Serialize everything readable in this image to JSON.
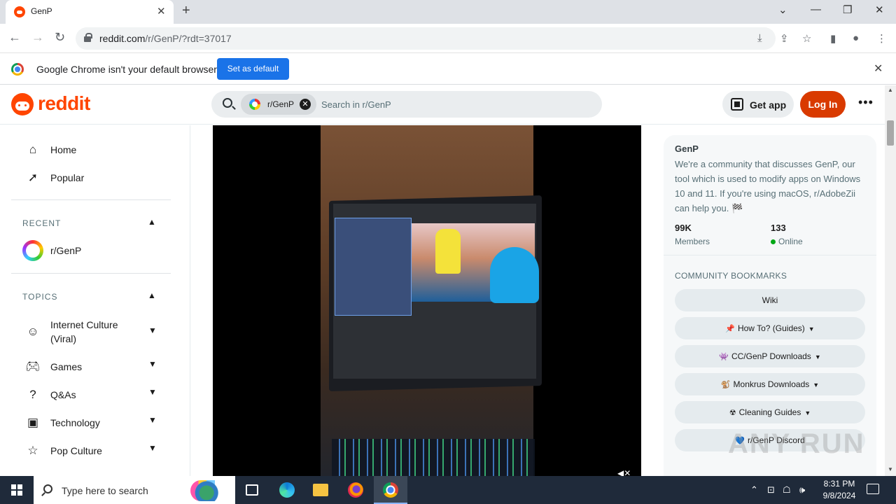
{
  "browser": {
    "tab_title": "GenP",
    "url_host": "reddit.com",
    "url_rest": "/r/GenP/?rdt=37017",
    "infobar_message": "Google Chrome isn't your default browser",
    "infobar_button": "Set as default"
  },
  "header": {
    "logo_text": "reddit",
    "search_chip": "r/GenP",
    "search_placeholder": "Search in r/GenP",
    "get_app": "Get app",
    "login": "Log In"
  },
  "leftnav": {
    "home": "Home",
    "popular": "Popular",
    "recent_head": "RECENT",
    "recent_item": "r/GenP",
    "topics_head": "TOPICS",
    "topics": [
      {
        "line1": "Internet Culture",
        "line2": "(Viral)"
      },
      {
        "line1": "Games"
      },
      {
        "line1": "Q&As"
      },
      {
        "line1": "Technology"
      },
      {
        "line1": "Pop Culture"
      }
    ]
  },
  "sidebar": {
    "name": "GenP",
    "description": "We're a community that discusses GenP, our tool which is used to modify apps on Windows 10 and 11. If you're using macOS, r/AdobeZii can help you. 🏁",
    "members_value": "99K",
    "members_label": "Members",
    "online_value": "133",
    "online_label": "Online",
    "bookmarks_head": "COMMUNITY BOOKMARKS",
    "bookmarks": [
      {
        "emoji": "",
        "label": "Wiki",
        "dropdown": false
      },
      {
        "emoji": "📌",
        "label": "How To? (Guides)",
        "dropdown": true
      },
      {
        "emoji": "👾",
        "label": "CC/GenP Downloads",
        "dropdown": true
      },
      {
        "emoji": "🐒",
        "label": "Monkrus Downloads",
        "dropdown": true
      },
      {
        "emoji": "☢",
        "label": "Cleaning Guides",
        "dropdown": true
      },
      {
        "emoji": "💙",
        "label": "r/GenP Discord",
        "dropdown": false
      }
    ]
  },
  "watermark": "ANY RUN",
  "taskbar": {
    "search_text": "Type here to search",
    "time": "8:31 PM",
    "date": "9/8/2024"
  }
}
